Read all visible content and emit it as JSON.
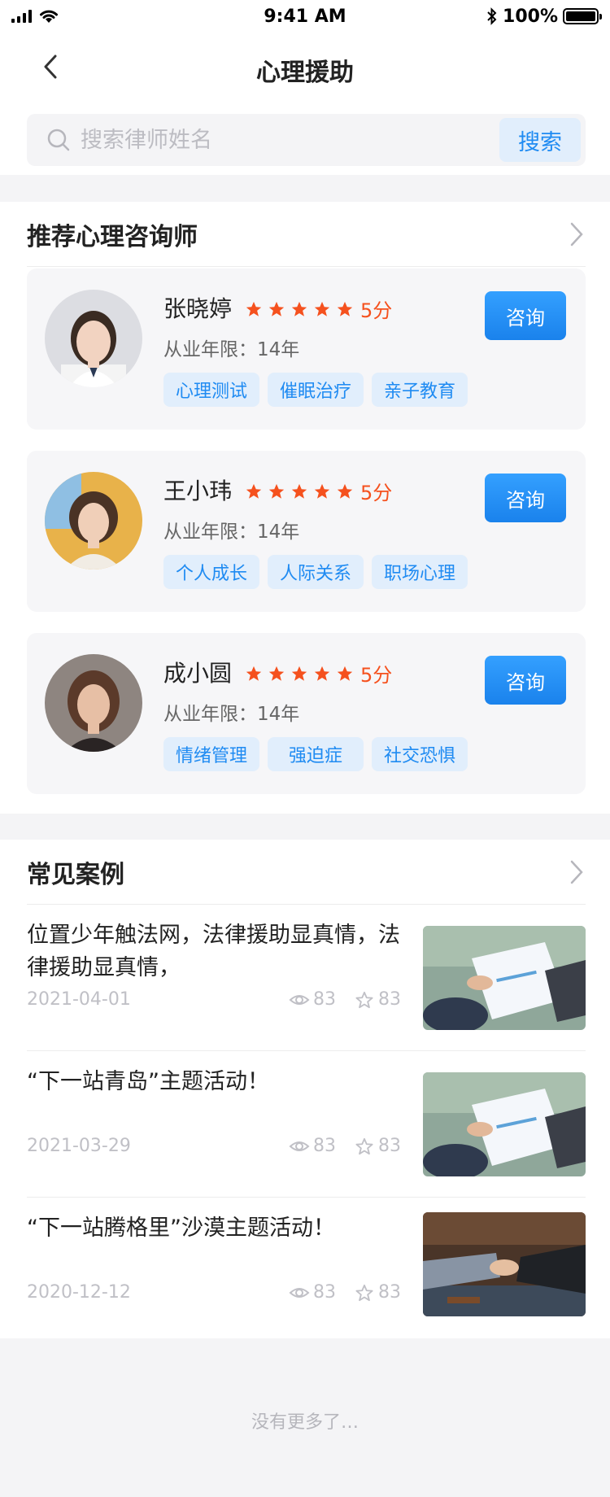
{
  "status_bar": {
    "time": "9:41 AM",
    "battery": "100%"
  },
  "header": {
    "title": "心理援助"
  },
  "search": {
    "placeholder": "搜索律师姓名",
    "button_label": "搜索"
  },
  "counselors_section": {
    "title": "推荐心理咨询师",
    "rating_suffix": "分",
    "items": [
      {
        "name": "张晓婷",
        "score": "5分",
        "years": "从业年限：14年",
        "tags": [
          "心理测试",
          "催眠治疗",
          "亲子教育"
        ],
        "button": "咨询"
      },
      {
        "name": "王小玮",
        "score": "5分",
        "years": "从业年限：14年",
        "tags": [
          "个人成长",
          "人际关系",
          "职场心理"
        ],
        "button": "咨询"
      },
      {
        "name": "成小圆",
        "score": "5分",
        "years": "从业年限：14年",
        "tags": [
          "情绪管理",
          "强迫症",
          "社交恐惧"
        ],
        "button": "咨询"
      }
    ]
  },
  "cases_section": {
    "title": "常见案例",
    "items": [
      {
        "title": "位置少年触法网，法律援助显真情，法律援助显真情，",
        "date": "2021-04-01",
        "views": "83",
        "favorites": "83"
      },
      {
        "title": "“下一站青岛”主题活动！",
        "date": "2021-03-29",
        "views": "83",
        "favorites": "83"
      },
      {
        "title": "“下一站腾格里”沙漠主题活动！",
        "date": "2020-12-12",
        "views": "83",
        "favorites": "83"
      }
    ]
  },
  "footer": {
    "no_more": "没有更多了…"
  },
  "colors": {
    "accent": "#1f8bf2",
    "star": "#f5511e",
    "tag_bg": "#e1eefc"
  }
}
